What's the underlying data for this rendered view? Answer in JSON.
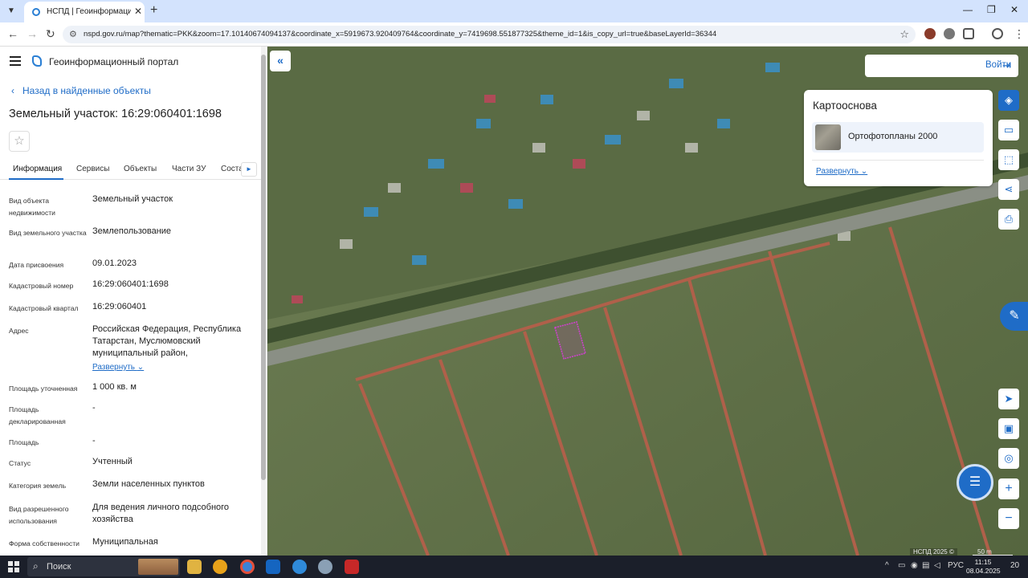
{
  "browser": {
    "tab_title": "НСПД | Геоинформационный",
    "url": "nspd.gov.ru/map?thematic=PKK&zoom=17.10140674094137&coordinate_x=5919673.920409764&coordinate_y=7419698.551877325&theme_id=1&is_copy_url=true&baseLayerId=36344"
  },
  "header": {
    "portal_name": "Геоинформационный портал"
  },
  "panel": {
    "back_link": "Назад в найденные объекты",
    "title": "Земельный участок: 16:29:060401:1698",
    "tabs": [
      {
        "label": "Информация"
      },
      {
        "label": "Сервисы"
      },
      {
        "label": "Объекты"
      },
      {
        "label": "Части ЗУ"
      },
      {
        "label": "Соста"
      }
    ],
    "rows": [
      {
        "label": "Вид объекта недвижимости",
        "value": "Земельный участок"
      },
      {
        "label": "Вид земельного участка",
        "value": "Землепользование"
      },
      {
        "label": "Дата присвоения",
        "value": "09.01.2023"
      },
      {
        "label": "Кадастровый номер",
        "value": "16:29:060401:1698"
      },
      {
        "label": "Кадастровый квартал",
        "value": "16:29:060401"
      },
      {
        "label": "Адрес",
        "value": "Российская Федерация, Республика Татарстан, Муслюмовский муниципальный район,"
      },
      {
        "label": "Площадь уточненная",
        "value": "1 000 кв. м"
      },
      {
        "label": "Площадь декларированная",
        "value": "-"
      },
      {
        "label": "Площадь",
        "value": "-"
      },
      {
        "label": "Статус",
        "value": "Учтенный"
      },
      {
        "label": "Категория земель",
        "value": "Земли населенных пунктов"
      },
      {
        "label": "Вид разрешенного использования",
        "value": "Для ведения личного подсобного хозяйства"
      },
      {
        "label": "Форма собственности",
        "value": "Муниципальная"
      }
    ],
    "expand_label": "Развернуть"
  },
  "map": {
    "login_label": "Войти",
    "basemap_title": "Картооснова",
    "basemap_item": "Ортофотопланы 2000",
    "basemap_expand": "Развернуть",
    "copyright": "НСПД 2025 ©",
    "scale": "50 m"
  },
  "taskbar": {
    "search_label": "Поиск",
    "lang": "РУС",
    "time": "11:15",
    "date": "08.04.2025",
    "notif_count": "20"
  }
}
